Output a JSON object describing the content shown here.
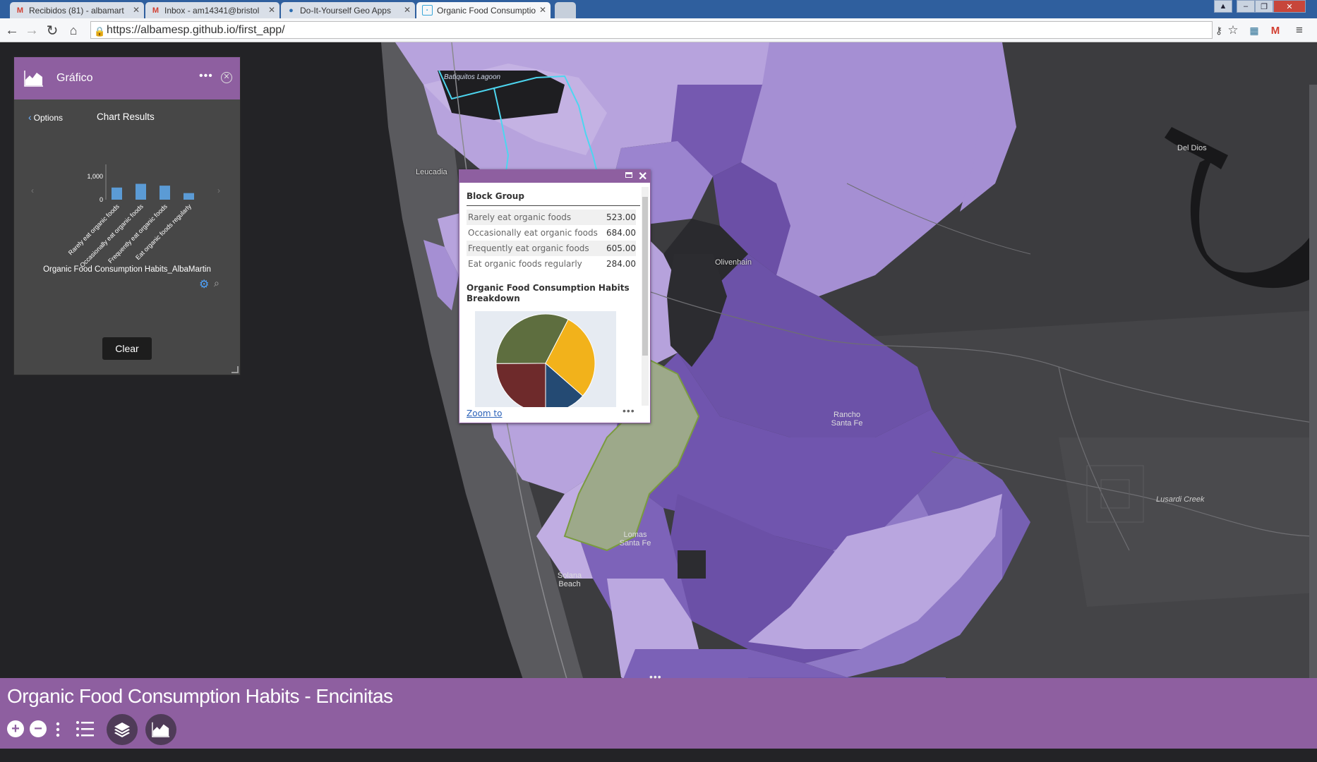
{
  "browser": {
    "tabs": [
      {
        "title": "Recibidos (81) - albamart",
        "icon": "gmail-icon"
      },
      {
        "title": "Inbox - am14341@bristol",
        "icon": "gmail-icon"
      },
      {
        "title": "Do-It-Yourself Geo Apps",
        "icon": "coursera-icon"
      },
      {
        "title": "Organic Food Consumptio",
        "icon": "page-icon"
      }
    ],
    "url": "https://albamesp.github.io/first_app/"
  },
  "chart_widget": {
    "title": "Gráfico",
    "options_label": "Options",
    "results_label": "Chart Results",
    "layer_name": "Organic Food Consumption Habits_AlbaMartin",
    "clear_label": "Clear"
  },
  "chart_data": {
    "type": "bar",
    "categories": [
      "Rarely eat organic foods",
      "Occasionally eat organic foods",
      "Frequently eat organic foods",
      "Eat organic foods regularly"
    ],
    "values": [
      523,
      684,
      605,
      284
    ],
    "ytick_labels": [
      "1,000",
      "0"
    ],
    "color": "#5b9bd5"
  },
  "popup": {
    "title": "Block Group",
    "attributes": [
      {
        "label": "Rarely eat organic foods",
        "value": "523.00"
      },
      {
        "label": "Occasionally eat organic foods",
        "value": "684.00"
      },
      {
        "label": "Frequently eat organic foods",
        "value": "605.00"
      },
      {
        "label": "Eat organic foods regularly",
        "value": "284.00"
      }
    ],
    "chart_title": "Organic Food Consumption Habits Breakdown",
    "zoom_label": "Zoom to",
    "pie": {
      "values": [
        523,
        684,
        605,
        284
      ],
      "colors": [
        "#6e2a2b",
        "#5e6e3f",
        "#f2b21b",
        "#244a73"
      ]
    }
  },
  "map_labels": [
    {
      "name": "san-elijo-lagoon-label",
      "text": "Batiquitos Lagoon"
    },
    {
      "name": "leucadia-label",
      "text": "Leucadia"
    },
    {
      "name": "olivenhain-label",
      "text": "Olivenhain"
    },
    {
      "name": "del-dios-label",
      "text": "Del Dios"
    },
    {
      "name": "rancho-santa-fe-label",
      "text": "Rancho Santa Fe"
    },
    {
      "name": "lomas-santa-fe-label",
      "text": "Lomas Santa Fe"
    },
    {
      "name": "solana-beach-label",
      "text": "Solana Beach"
    },
    {
      "name": "lusardi-creek-label",
      "text": "Lusardi Creek"
    }
  ],
  "app": {
    "title": "Organic Food Consumption Habits - Encinitas",
    "theme_color": "#8e5fa0"
  }
}
